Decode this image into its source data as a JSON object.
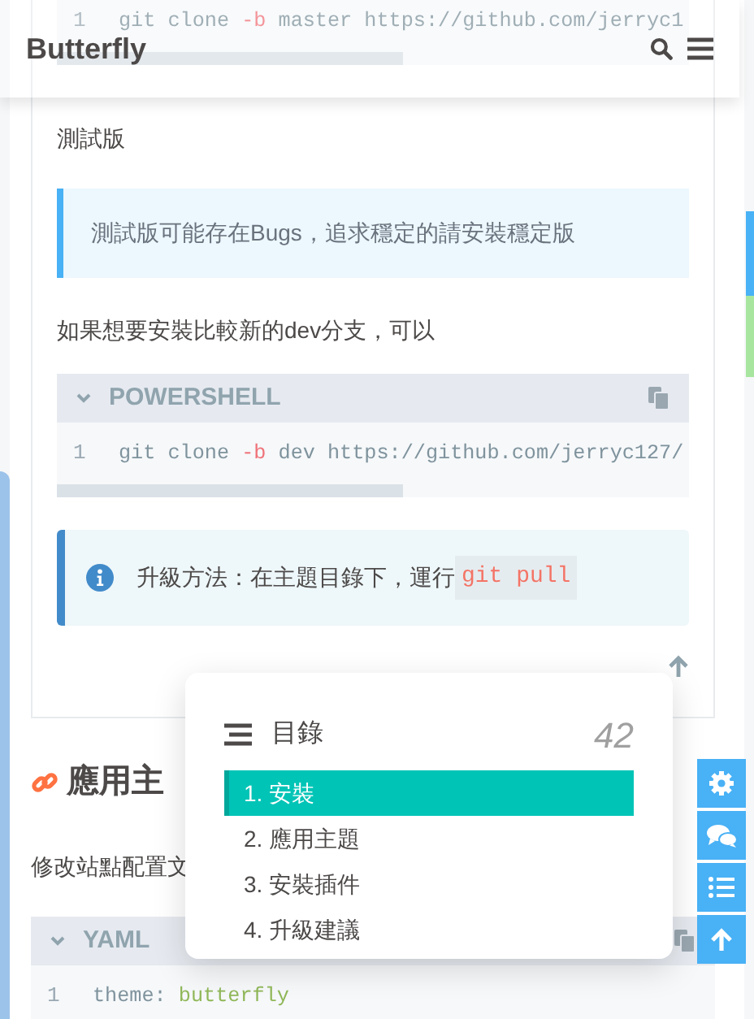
{
  "header": {
    "title": "Butterfly"
  },
  "article": [
    {
      "kind": "code",
      "lines": [
        {
          "number": "1",
          "tokens": [
            {
              "kind": "plain",
              "text": "git clone "
            },
            {
              "kind": "flag",
              "text": "-b"
            },
            {
              "kind": "plain",
              "text": " master https://github.com/jerryc1"
            }
          ]
        }
      ]
    },
    {
      "kind": "paragraph",
      "text": "測試版"
    },
    {
      "kind": "quote",
      "text": "測試版可能存在Bugs，追求穩定的請安裝穩定版"
    },
    {
      "kind": "paragraph",
      "text": "如果想要安裝比較新的dev分支，可以"
    },
    {
      "kind": "code",
      "language": "POWERSHELL",
      "lines": [
        {
          "number": "1",
          "tokens": [
            {
              "kind": "plain",
              "text": "git clone "
            },
            {
              "kind": "flag",
              "text": "-b"
            },
            {
              "kind": "plain",
              "text": " dev https://github.com/jerryc127/"
            }
          ]
        }
      ]
    },
    {
      "kind": "note",
      "text": "升級方法：在主題目錄下，運行",
      "code": "git pull"
    }
  ],
  "section": {
    "heading": "應用主",
    "paragraph": "修改站點配置文",
    "code": {
      "language": "YAML",
      "lines": [
        {
          "number": "1",
          "tokens": [
            {
              "kind": "plain",
              "text": "theme:"
            },
            {
              "kind": "string",
              "text": "butterfly"
            }
          ]
        }
      ]
    }
  },
  "toc": {
    "title": "目錄",
    "count": "42",
    "items": [
      {
        "label": "1. 安裝",
        "selected": true
      },
      {
        "label": "2. 應用主題",
        "selected": false
      },
      {
        "label": "3. 安裝插件",
        "selected": false
      },
      {
        "label": "4. 升級建議",
        "selected": false
      }
    ]
  }
}
